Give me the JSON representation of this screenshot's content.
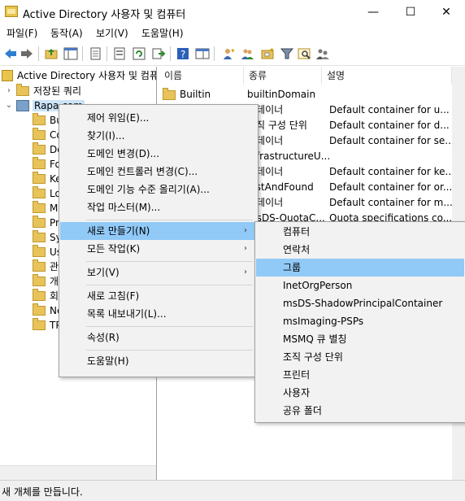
{
  "window": {
    "title": "Active Directory 사용자 및 컴퓨터",
    "minimize_glyph": "—",
    "maximize_glyph": "☐",
    "close_glyph": "✕"
  },
  "menubar": [
    "파일(F)",
    "동작(A)",
    "보기(V)",
    "도움말(H)"
  ],
  "toolbar": {
    "icons": [
      "back-icon",
      "forward-icon",
      "up-folder-icon",
      "console-tree-icon",
      "copy-icon",
      "export-list-icon",
      "refresh-icon",
      "export-icon",
      "help-icon",
      "show-hide-icon",
      "add-user-icon",
      "add-group-icon",
      "add-ou-icon",
      "filter-icon",
      "find-icon",
      "delegate-icon"
    ]
  },
  "tree": {
    "root": "Active Directory 사용자 및 컴퓨",
    "saved_queries": "저장된 쿼리",
    "domain": "Rapa.com",
    "children": [
      "Bu",
      "Co",
      "Do",
      "Fo",
      "Ke",
      "Lo",
      "Ma",
      "Pr",
      "Sy",
      "Us",
      "관",
      "개",
      "회",
      "Ne",
      "TP"
    ]
  },
  "list": {
    "columns": [
      "이름",
      "종류",
      "설명"
    ],
    "rows": [
      {
        "name": "Builtin",
        "type": "builtinDomain",
        "desc": ""
      },
      {
        "name": "",
        "type": "컨테이너",
        "desc": "Default container for u..."
      },
      {
        "name": "",
        "type": "조직 구성 단위",
        "desc": "Default container for d..."
      },
      {
        "name": "",
        "type": "컨테이너",
        "desc": "Default container for se..."
      },
      {
        "name": "",
        "type": "infrastructureU...",
        "desc": ""
      },
      {
        "name": "",
        "type": "컨테이너",
        "desc": "Default container for ke..."
      },
      {
        "name": "",
        "type": "lostAndFound",
        "desc": "Default container for or..."
      },
      {
        "name": "",
        "type": "컨테이너",
        "desc": "Default container for m..."
      },
      {
        "name": "",
        "type": "msDS-QuotaC...",
        "desc": "Quota specifications co..."
      }
    ]
  },
  "context_menu": {
    "items": [
      "제어 위임(E)...",
      "찾기(I)...",
      "도메인 변경(D)...",
      "도메인 컨트롤러 변경(C)...",
      "도메인 기능 수준 올리기(A)...",
      "작업 마스터(M)...",
      "새로 만들기(N)",
      "모든 작업(K)",
      "보기(V)",
      "새로 고침(F)",
      "목록 내보내기(L)...",
      "속성(R)",
      "도움말(H)"
    ],
    "submenu_arrow": "›"
  },
  "submenu": {
    "items": [
      "컴퓨터",
      "연락처",
      "그룹",
      "InetOrgPerson",
      "msDS-ShadowPrincipalContainer",
      "msImaging-PSPs",
      "MSMQ 큐 별칭",
      "조직 구성 단위",
      "프린터",
      "사용자",
      "공유 폴더"
    ]
  },
  "status": "새 개체를 만듭니다.",
  "colors": {
    "highlight": "#91c9f7",
    "menu_bg": "#f2f2f2"
  }
}
